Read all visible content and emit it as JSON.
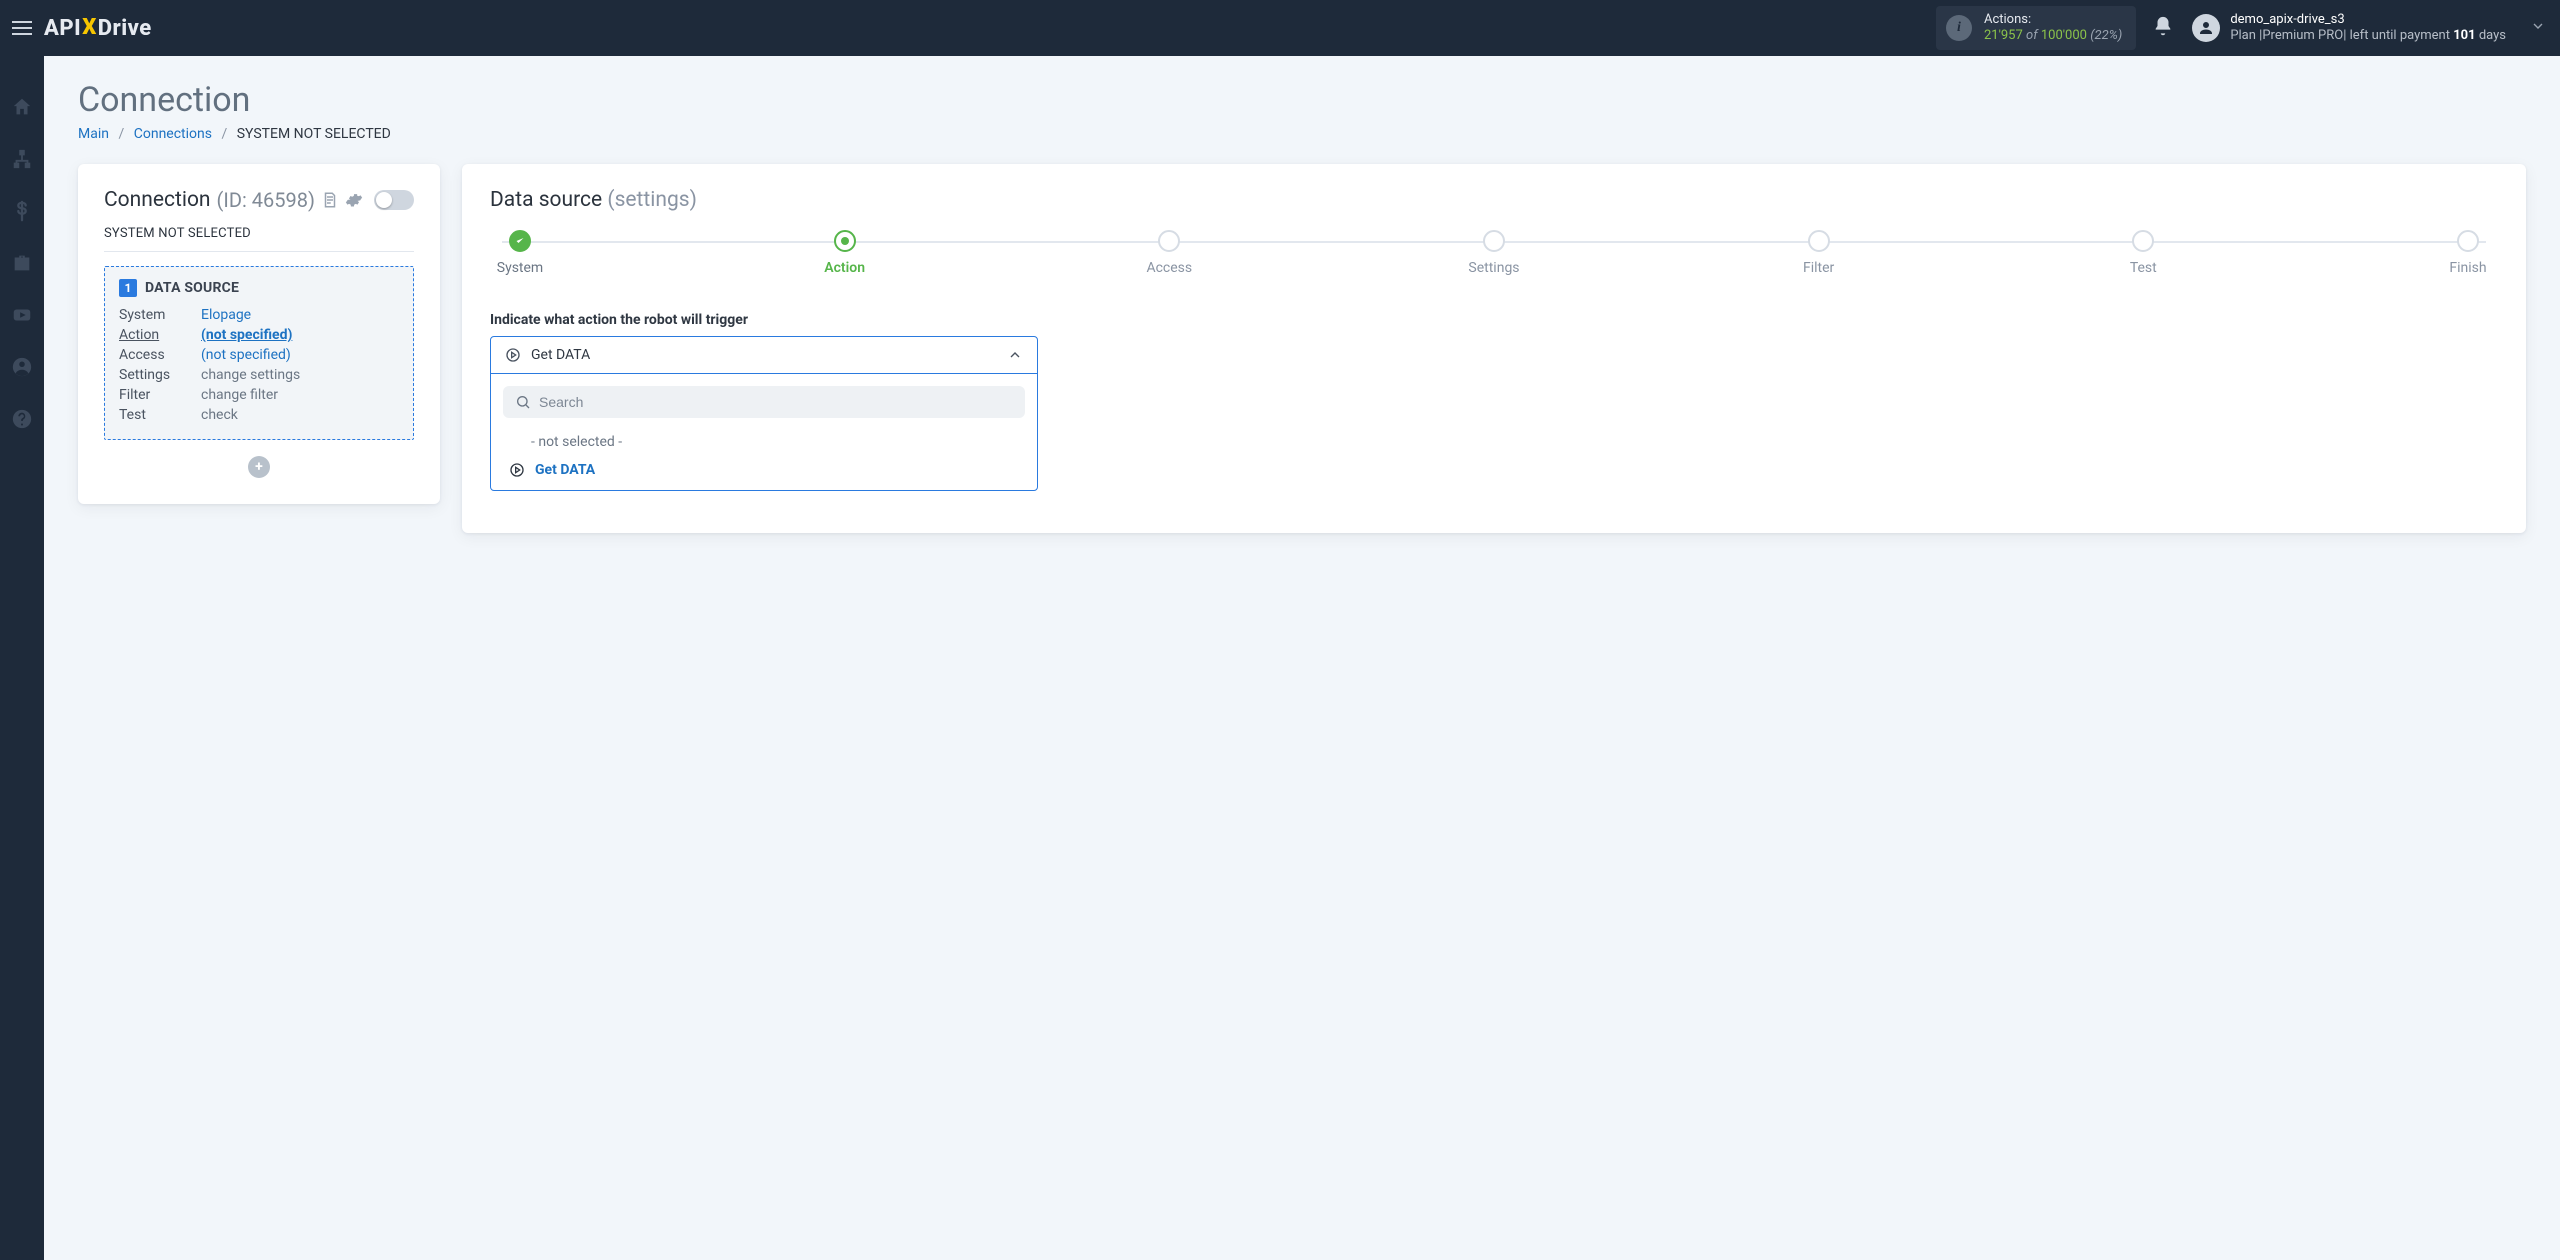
{
  "brand": {
    "pre": "API",
    "x": "X",
    "post": "Drive"
  },
  "actions_box": {
    "label": "Actions:",
    "used": "21'957",
    "of": "of",
    "total": "100'000",
    "pct": "(22%)"
  },
  "user": {
    "name": "demo_apix-drive_s3",
    "plan_prefix": "Plan |",
    "plan_name": "Premium PRO",
    "plan_mid": "| left until payment ",
    "days_bold": "101",
    "days_suffix": " days"
  },
  "rail": {
    "home": "home-icon",
    "sitemap": "sitemap-icon",
    "money": "dollar-icon",
    "briefcase": "briefcase-icon",
    "video": "video-icon",
    "account": "user-circle-icon",
    "help": "help-icon"
  },
  "page": {
    "title": "Connection",
    "crumbs": {
      "main": "Main",
      "connections": "Connections",
      "current": "SYSTEM NOT SELECTED"
    }
  },
  "left_card": {
    "title": "Connection",
    "id_label": "(ID: 46598)",
    "subtitle": "SYSTEM NOT SELECTED",
    "ds_badge": "1",
    "ds_title": "DATA SOURCE",
    "rows": {
      "system_k": "System",
      "system_v": "Elopage",
      "action_k": "Action",
      "action_v": "(not specified)",
      "access_k": "Access",
      "access_v": "(not specified)",
      "settings_k": "Settings",
      "settings_v": "change settings",
      "filter_k": "Filter",
      "filter_v": "change filter",
      "test_k": "Test",
      "test_v": "check"
    },
    "plus": "+"
  },
  "right_card": {
    "heading": "Data source",
    "heading_muted": "(settings)",
    "steps": {
      "system": "System",
      "action": "Action",
      "access": "Access",
      "settings": "Settings",
      "filter": "Filter",
      "test": "Test",
      "finish": "Finish"
    },
    "field_label": "Indicate what action the robot will trigger",
    "select_value": "Get DATA",
    "search_placeholder": "Search",
    "opt_not_selected": "- not selected -",
    "opt_get_data": "Get DATA"
  }
}
